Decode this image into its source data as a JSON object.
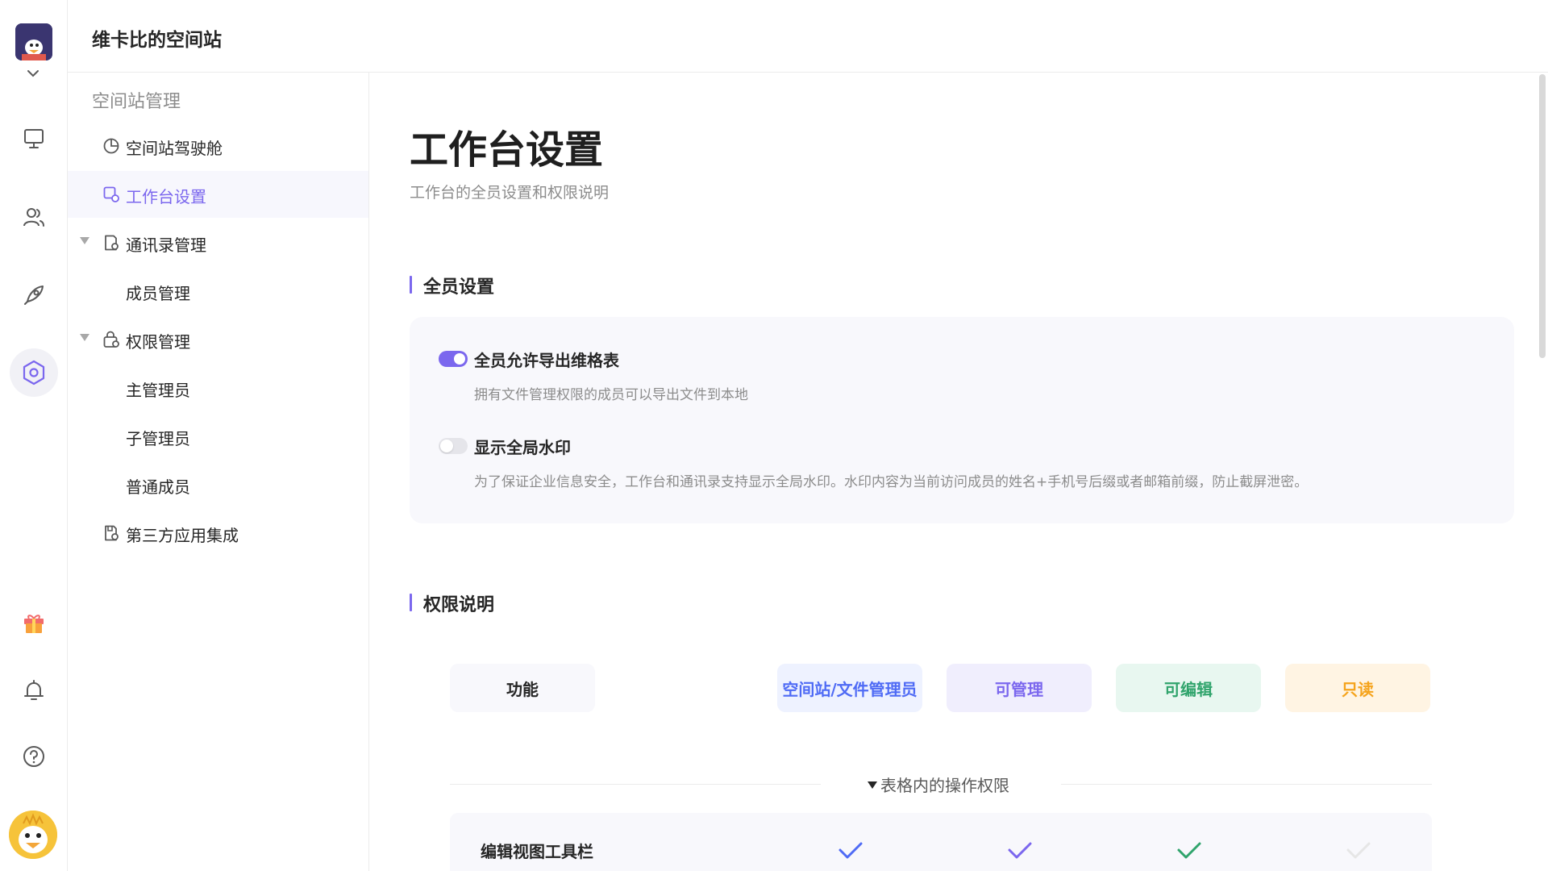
{
  "space": {
    "name": "维卡比的空间站",
    "logo_text": "维卡比的空间站"
  },
  "sidebar": {
    "group_title": "空间站管理",
    "items": [
      {
        "label": "空间站驾驶舱",
        "icon": "pie-chart-icon"
      },
      {
        "label": "工作台设置",
        "icon": "workbench-settings-icon",
        "active": true
      },
      {
        "label": "通讯录管理",
        "icon": "contacts-icon",
        "expanded": true
      },
      {
        "label": "成员管理"
      },
      {
        "label": "权限管理",
        "icon": "permission-icon",
        "expanded": true
      },
      {
        "label": "主管理员"
      },
      {
        "label": "子管理员"
      },
      {
        "label": "普通成员"
      },
      {
        "label": "第三方应用集成",
        "icon": "integration-icon"
      }
    ]
  },
  "page": {
    "title": "工作台设置",
    "subtitle": "工作台的全员设置和权限说明"
  },
  "all_member_settings": {
    "title": "全员设置",
    "settings": [
      {
        "label": "全员允许导出维格表",
        "description": "拥有文件管理权限的成员可以导出文件到本地",
        "enabled": true
      },
      {
        "label": "显示全局水印",
        "description": "为了保证企业信息安全，工作台和通讯录支持显示全局水印。水印内容为当前访问成员的姓名+手机号后缀或者邮箱前缀，防止截屏泄密。",
        "enabled": false
      }
    ]
  },
  "permissions": {
    "title": "权限说明",
    "columns": {
      "feature": "功能",
      "admin": "空间站/文件管理员",
      "manage": "可管理",
      "edit": "可编辑",
      "readonly": "只读"
    },
    "section_label": "表格内的操作权限",
    "rows": [
      {
        "label": "编辑视图工具栏",
        "admin": true,
        "manage": true,
        "edit": true,
        "readonly": false
      }
    ]
  },
  "colors": {
    "accent": "#7b67ee",
    "admin_bg": "#eef2ff",
    "admin_fg": "#4f6bf5",
    "manage_bg": "#f0eefd",
    "manage_fg": "#7b67ee",
    "edit_bg": "#e8f7f0",
    "edit_fg": "#30a46c",
    "readonly_bg": "#fff4e3",
    "readonly_fg": "#f5a31b"
  }
}
